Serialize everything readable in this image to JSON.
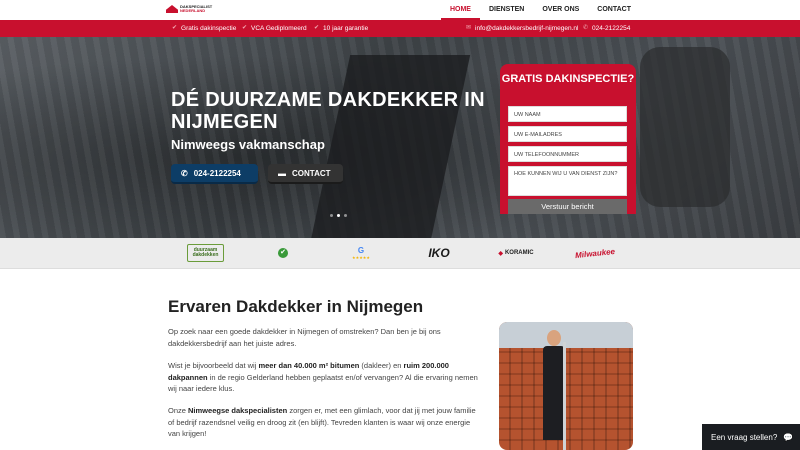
{
  "header": {
    "logo_line1": "DAKSPECIALIST",
    "logo_line2": "NEDERLAND",
    "nav": [
      "HOME",
      "DIENSTEN",
      "OVER ONS",
      "CONTACT"
    ]
  },
  "topbar": {
    "usps": [
      "Gratis dakinspectie",
      "VCA Gediplomeerd",
      "10 jaar garantie"
    ],
    "email": "info@dakdekkersbedrijf-nijmegen.nl",
    "phone": "024-2122254"
  },
  "hero": {
    "title": "DÉ DUURZAME DAKDEKKER IN NIJMEGEN",
    "subtitle": "Nimweegs vakmanschap",
    "phone_button": "024-2122254",
    "contact_button": "CONTACT"
  },
  "form": {
    "title": "GRATIS DAKINSPECTIE?",
    "name_placeholder": "UW NAAM",
    "email_placeholder": "UW E-MAILADRES",
    "phone_placeholder": "UW TELEFOONNUMMER",
    "message_placeholder": "HOE KUNNEN WIJ U VAN DIENST ZIJN?",
    "submit": "Verstuur bericht"
  },
  "brands": {
    "duurzaam_1": "duurzaam",
    "duurzaam_2": "dakdekken",
    "google": "G",
    "stars": "★★★★★",
    "iko": "IKO",
    "koramic": "KORAMIC",
    "milwaukee": "Milwaukee"
  },
  "content": {
    "heading": "Ervaren Dakdekker in Nijmegen",
    "p1": "Op zoek naar een goede dakdekker in Nijmegen of omstreken? Dan ben je bij ons dakdekkersbedrijf aan het juiste adres.",
    "p2_a": "Wist je bijvoorbeeld dat wij ",
    "p2_b": "meer dan 40.000 m² bitumen",
    "p2_c": " (dakleer) en ",
    "p2_d": "ruim 200.000 dakpannen",
    "p2_e": " in de regio Gelderland hebben geplaatst en/of vervangen? Al die ervaring nemen wij naar iedere klus.",
    "p3_a": "Onze ",
    "p3_b": "Nimweegse dakspecialisten",
    "p3_c": " zorgen er, met een glimlach, voor dat jij met jouw familie of bedrijf razendsnel veilig en droog zit (en blijft). Tevreden klanten is waar wij onze energie van krijgen!"
  },
  "chat": {
    "label": "Een vraag stellen?"
  },
  "colors": {
    "brand_red": "#c8102e",
    "navy": "#0d3d66"
  }
}
